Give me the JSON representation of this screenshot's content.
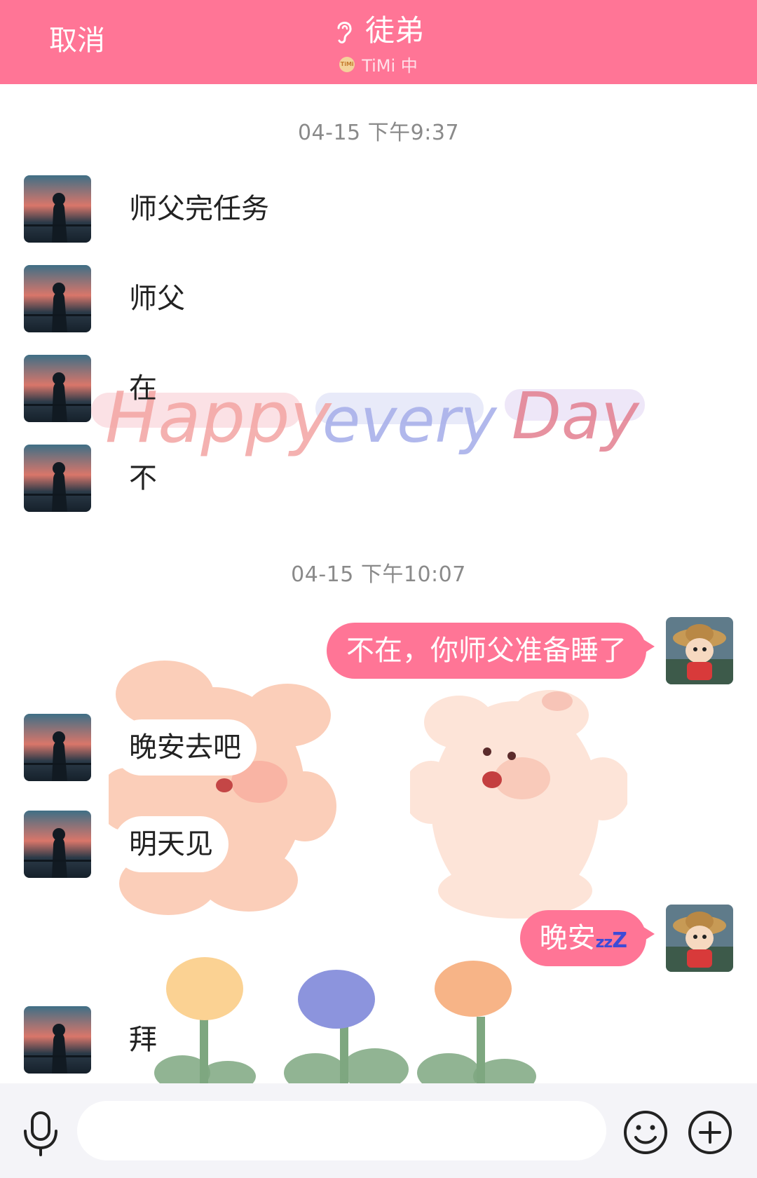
{
  "header": {
    "cancel_label": "取消",
    "contact_name": "徒弟",
    "status_text": "TiMi 中",
    "status_icon_label": "TiMi",
    "background_color": "#ff7596"
  },
  "chat": {
    "timestamps": [
      "04-15 下午9:37",
      "04-15 下午10:07"
    ],
    "messages": [
      {
        "side": "left",
        "text": "师父完任务"
      },
      {
        "side": "left",
        "text": "师父"
      },
      {
        "side": "left",
        "text": "在"
      },
      {
        "side": "left",
        "text": "不"
      },
      {
        "side": "right",
        "text": "不在，你师父准备睡了"
      },
      {
        "side": "left",
        "text": "晚安去吧"
      },
      {
        "side": "left",
        "text": "明天见"
      },
      {
        "side": "right",
        "text": "晚安",
        "suffix_small": "zz",
        "suffix_big": "Z"
      },
      {
        "side": "left",
        "text": "拜"
      }
    ],
    "wallpaper_text": [
      "Happy",
      "every",
      "Day"
    ],
    "bubble_color_right": "#ff7596"
  },
  "input_bar": {
    "placeholder": "",
    "icons": [
      "microphone-icon",
      "emoji-icon",
      "plus-icon"
    ]
  }
}
